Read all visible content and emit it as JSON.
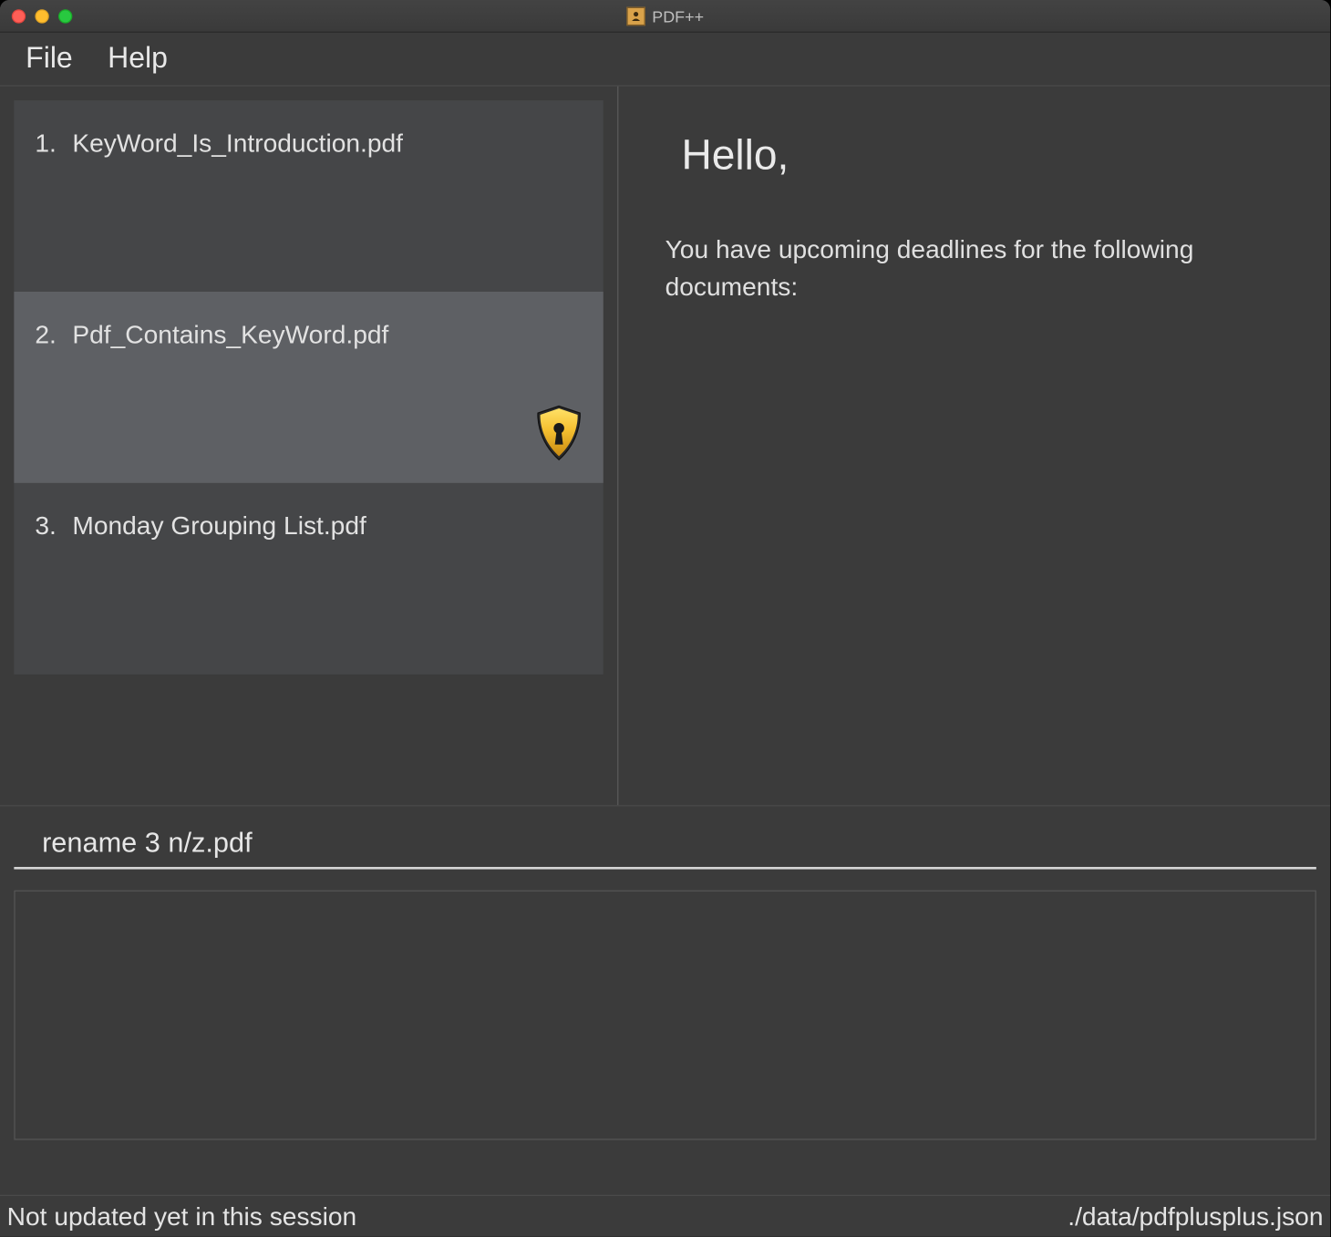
{
  "window": {
    "title": "PDF++"
  },
  "menubar": {
    "items": [
      "File",
      "Help"
    ]
  },
  "sidebar": {
    "files": [
      {
        "index": "1.",
        "name": "KeyWord_Is_Introduction.pdf",
        "selected": false,
        "locked": false
      },
      {
        "index": "2.",
        "name": "Pdf_Contains_KeyWord.pdf",
        "selected": true,
        "locked": true
      },
      {
        "index": "3.",
        "name": "Monday Grouping List.pdf",
        "selected": false,
        "locked": false
      }
    ]
  },
  "content": {
    "greeting": "Hello,",
    "deadline_text": "You have upcoming deadlines for the following documents:"
  },
  "command": {
    "value": "rename 3 n/z.pdf"
  },
  "statusbar": {
    "left": "Not updated yet in this session",
    "right": "./data/pdfplusplus.json"
  }
}
